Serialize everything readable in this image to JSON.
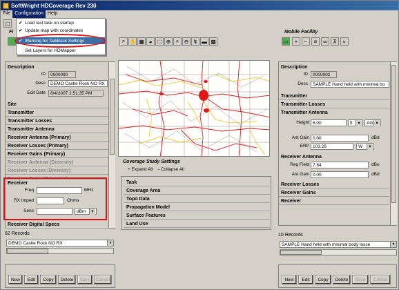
{
  "window": {
    "title": "SoftWright HDCoverage Rev 230"
  },
  "menubar": [
    "File",
    "Configuration",
    "Help"
  ],
  "config_menu": {
    "items": [
      {
        "label": "Load last task on startup",
        "checked": true
      },
      {
        "label": "Update map with coordinates",
        "checked": true
      },
      {
        "label": "Warning for TalkBack Settings",
        "checked": true,
        "highlighted": true
      },
      {
        "label": "Set Layers for HDMapper",
        "checked": false
      }
    ]
  },
  "toolbar": {
    "fixed_label": "Fi",
    "mobile_label": "Mobile Facility"
  },
  "left_panel": {
    "description_header": "Description",
    "id_label": "ID",
    "id_value": "0000090",
    "desc_label": "Desc",
    "desc_value": "DEMO Castle Rock NO RX",
    "editdate_label": "Edit Date",
    "editdate_value": "6/4/2007 2:51:35 PM",
    "sections": [
      "Site",
      "Transmitter",
      "Transmitter Losses",
      "Transmitter Antenna",
      "Receiver Antenna (Primary)",
      "Receiver Losses (Primary)",
      "Receiver Gains (Primary)",
      "Receiver Antenna (Diversity)",
      "Receiver Losses (Diversity)",
      "Receiver Gains (Diversity)"
    ],
    "receiver_header": "Receiver",
    "freq_label": "Freq",
    "freq_unit": "MHz",
    "rximped_label": "RX Imped",
    "rximped_unit": "Ohms",
    "sens_label": "Sens",
    "sens_unit": "dBm",
    "digital_specs": "Receiver Digital Specs",
    "records": "62 Records",
    "selected_record": "DEMO Castle Rock NO RX",
    "buttons": [
      "New",
      "Edit",
      "Copy",
      "Delete",
      "Save",
      "Cancel"
    ]
  },
  "center": {
    "study_title": "Coverage Study Settings",
    "expand_all": "+ Expand All",
    "collapse_all": "- Collapse All",
    "sections": [
      "Task",
      "Coverage Area",
      "Topo Data",
      "Propagation Model",
      "Surface Features",
      "Land Use"
    ]
  },
  "right_panel": {
    "description_header": "Description",
    "id_label": "ID",
    "id_value": "0000002",
    "desc_label": "Desc",
    "desc_value": "SAMPLE Hand held with minimal bo",
    "transmitter": "Transmitter",
    "transmitter_losses": "Transmitter Losses",
    "transmitter_antenna": "Transmitter Antenna",
    "height_label": "Height",
    "height_value": "6.00",
    "height_unit": "ft",
    "height_ref": "AGL",
    "antgain_label": "Ant Gain",
    "antgain_value": "0.00",
    "antgain_unit": "dBd",
    "erp_label": "ERP",
    "erp_value": "103.28",
    "erp_unit": "W",
    "receiver_antenna": "Receiver Antenna",
    "reqfield_label": "Req Field",
    "reqfield_value": "7.84",
    "reqfield_unit": "dBu",
    "rx_antgain_label": "Ant Gain",
    "rx_antgain_value": "0.00",
    "rx_antgain_unit": "dBd",
    "receiver_losses": "Receiver Losses",
    "receiver_gains": "Receiver Gains",
    "receiver": "Receiver",
    "records": "10 Records",
    "selected_record": "SAMPLE Hand held with minimal body losse",
    "buttons": [
      "New",
      "Edit",
      "Copy",
      "Delete",
      "Save",
      "Cancel"
    ]
  },
  "colors": {
    "title_bar": "#0a246a",
    "highlight_oval": "#e01010",
    "menu_highlight": "#3a6ea5"
  }
}
